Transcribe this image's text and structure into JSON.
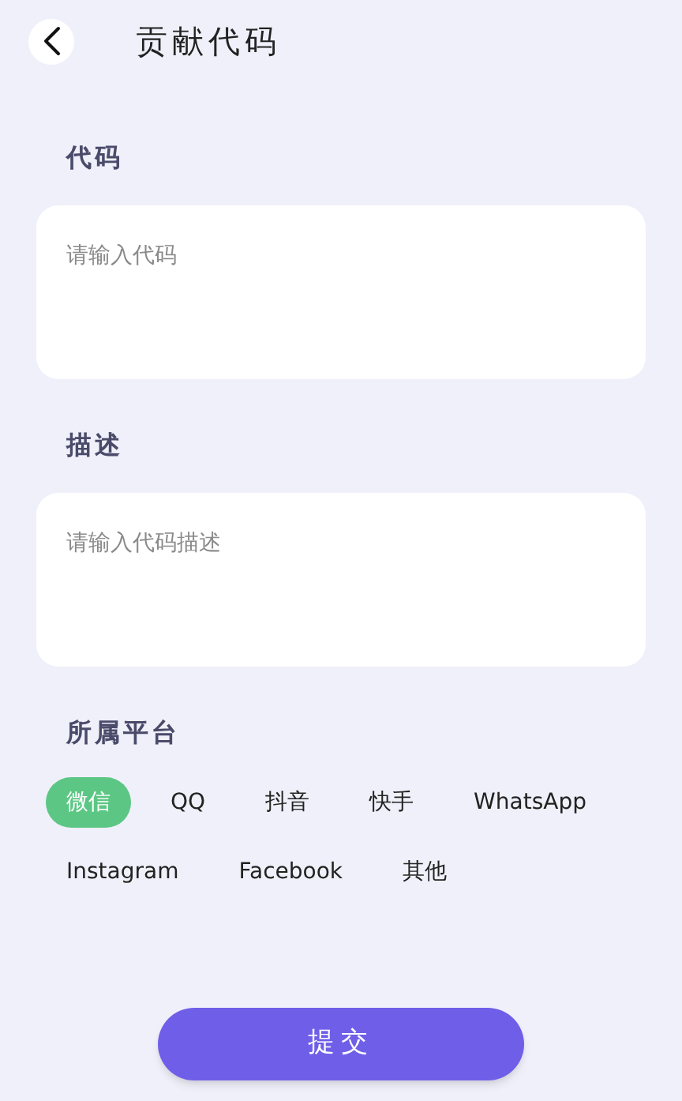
{
  "header": {
    "title": "贡献代码"
  },
  "sections": [
    {
      "label": "代码",
      "placeholder": "请输入代码"
    },
    {
      "label": "描述",
      "placeholder": "请输入代码描述"
    }
  ],
  "platform": {
    "label": "所属平台",
    "options": [
      {
        "label": "微信",
        "selected": true
      },
      {
        "label": "QQ",
        "selected": false
      },
      {
        "label": "抖音",
        "selected": false
      },
      {
        "label": "快手",
        "selected": false
      },
      {
        "label": "WhatsApp",
        "selected": false
      },
      {
        "label": "Instagram",
        "selected": false
      },
      {
        "label": "Facebook",
        "selected": false
      },
      {
        "label": "其他",
        "selected": false
      }
    ]
  },
  "submit": {
    "label": "提交"
  }
}
